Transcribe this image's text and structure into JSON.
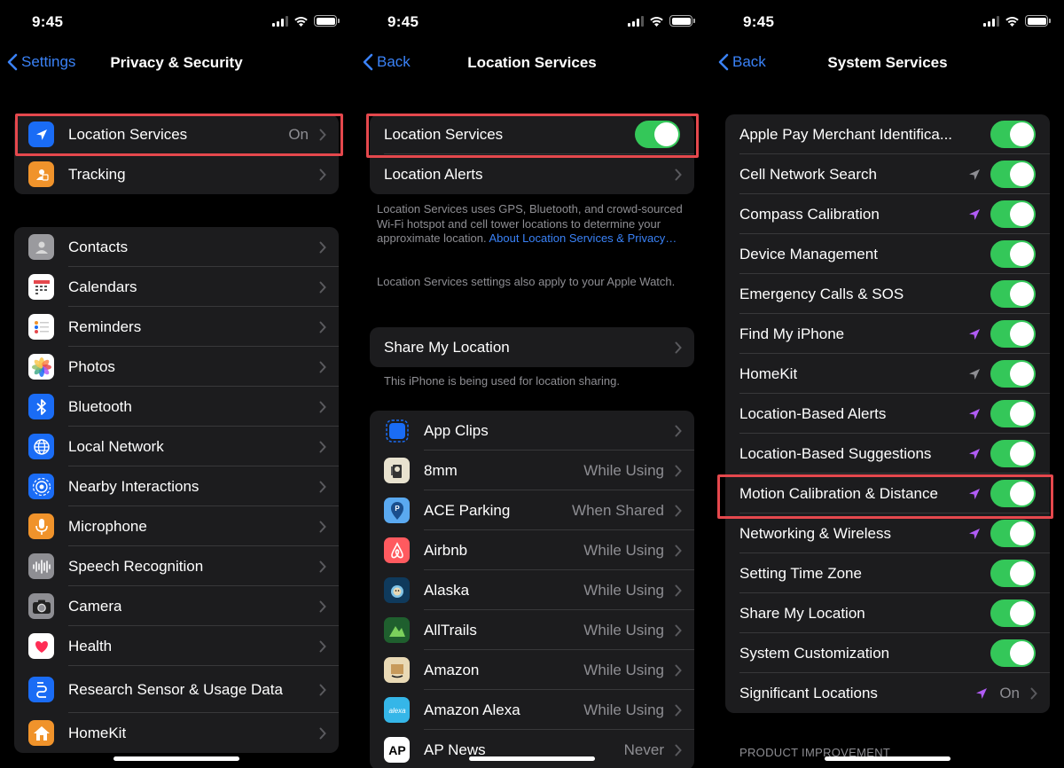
{
  "status": {
    "time": "9:45"
  },
  "screen1": {
    "back_label": "Settings",
    "title": "Privacy & Security",
    "group1": [
      {
        "label": "Location Services",
        "value": "On",
        "icon": "location-arrow-icon",
        "color": "#1a6cf5"
      },
      {
        "label": "Tracking",
        "value": "",
        "icon": "tracking-icon",
        "color": "#f0932b"
      }
    ],
    "group2": [
      {
        "label": "Contacts",
        "icon": "contacts-icon",
        "color": "#9a9a9e"
      },
      {
        "label": "Calendars",
        "icon": "calendar-icon",
        "color": "#ffffff"
      },
      {
        "label": "Reminders",
        "icon": "reminders-icon",
        "color": "#ffffff"
      },
      {
        "label": "Photos",
        "icon": "photos-icon",
        "color": "#ffffff"
      },
      {
        "label": "Bluetooth",
        "icon": "bluetooth-icon",
        "color": "#1a6cf5"
      },
      {
        "label": "Local Network",
        "icon": "globe-icon",
        "color": "#1a6cf5"
      },
      {
        "label": "Nearby Interactions",
        "icon": "nearby-icon",
        "color": "#1a6cf5"
      },
      {
        "label": "Microphone",
        "icon": "microphone-icon",
        "color": "#f0932b"
      },
      {
        "label": "Speech Recognition",
        "icon": "waveform-icon",
        "color": "#8e8e93"
      },
      {
        "label": "Camera",
        "icon": "camera-icon",
        "color": "#8e8e93"
      },
      {
        "label": "Health",
        "icon": "heart-icon",
        "color": "#ffffff"
      },
      {
        "label": "Research Sensor & Usage Data",
        "icon": "research-icon",
        "color": "#1a6cf5"
      },
      {
        "label": "HomeKit",
        "icon": "home-icon",
        "color": "#f0932b"
      }
    ]
  },
  "screen2": {
    "back_label": "Back",
    "title": "Location Services",
    "toggle_label": "Location Services",
    "alerts_label": "Location Alerts",
    "footnote1": "Location Services uses GPS, Bluetooth, and crowd-sourced Wi-Fi hotspot and cell tower locations to determine your approximate location.",
    "footnote1_link": "About Location Services & Privacy…",
    "footnote2": "Location Services settings also apply to your Apple Watch.",
    "share_label": "Share My Location",
    "share_footnote": "This iPhone is being used for location sharing.",
    "apps": [
      {
        "label": "App Clips",
        "value": "",
        "icon": "app-clips-icon",
        "color": "#1a6cf5"
      },
      {
        "label": "8mm",
        "value": "While Using",
        "icon": "8mm-icon",
        "color": "#e8e2cf"
      },
      {
        "label": "ACE Parking",
        "value": "When Shared",
        "icon": "ace-parking-icon",
        "color": "#5aa9f0"
      },
      {
        "label": "Airbnb",
        "value": "While Using",
        "icon": "airbnb-icon",
        "color": "#ff5a5f"
      },
      {
        "label": "Alaska",
        "value": "While Using",
        "icon": "alaska-icon",
        "color": "#0f3a5c"
      },
      {
        "label": "AllTrails",
        "value": "While Using",
        "icon": "alltrails-icon",
        "color": "#1f5f2e"
      },
      {
        "label": "Amazon",
        "value": "While Using",
        "icon": "amazon-icon",
        "color": "#e9d9b5"
      },
      {
        "label": "Amazon Alexa",
        "value": "While Using",
        "icon": "alexa-icon",
        "color": "#35b6e8"
      },
      {
        "label": "AP News",
        "value": "Never",
        "icon": "ap-news-icon",
        "color": "#ffffff"
      }
    ]
  },
  "screen3": {
    "back_label": "Back",
    "title": "System Services",
    "services": [
      {
        "label": "Apple Pay Merchant Identifica...",
        "arrow": "none"
      },
      {
        "label": "Cell Network Search",
        "arrow": "gray"
      },
      {
        "label": "Compass Calibration",
        "arrow": "purple"
      },
      {
        "label": "Device Management",
        "arrow": "none"
      },
      {
        "label": "Emergency Calls & SOS",
        "arrow": "none"
      },
      {
        "label": "Find My iPhone",
        "arrow": "purple"
      },
      {
        "label": "HomeKit",
        "arrow": "gray"
      },
      {
        "label": "Location-Based Alerts",
        "arrow": "purple"
      },
      {
        "label": "Location-Based Suggestions",
        "arrow": "purple"
      },
      {
        "label": "Motion Calibration & Distance",
        "arrow": "purple"
      },
      {
        "label": "Networking & Wireless",
        "arrow": "purple"
      },
      {
        "label": "Setting Time Zone",
        "arrow": "none"
      },
      {
        "label": "Share My Location",
        "arrow": "none"
      },
      {
        "label": "System Customization",
        "arrow": "none"
      }
    ],
    "significant_label": "Significant Locations",
    "significant_value": "On",
    "section_header": "PRODUCT IMPROVEMENT"
  },
  "colors": {
    "accent": "#3a82f7",
    "toggle_on": "#34c759",
    "arrow_purple": "#b15cf6",
    "arrow_gray": "#8e8e93",
    "highlight": "#e5484d"
  }
}
